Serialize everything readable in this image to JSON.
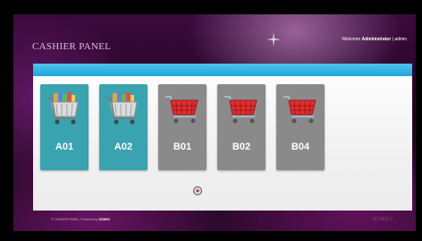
{
  "header": {
    "title": "CASHIER PANEL",
    "welcome_prefix": "Welcome",
    "user": "Administrator",
    "separator": "|",
    "logout_label": "admin"
  },
  "registers": [
    {
      "label": "A01",
      "status": "occupied",
      "icon": "full-cart-icon",
      "color": "#3aa3b0"
    },
    {
      "label": "A02",
      "status": "occupied",
      "icon": "full-cart-icon",
      "color": "#3aa3b0"
    },
    {
      "label": "B01",
      "status": "empty",
      "icon": "empty-cart-icon",
      "color": "#8a8a8a"
    },
    {
      "label": "B02",
      "status": "empty",
      "icon": "empty-cart-icon",
      "color": "#8a8a8a"
    },
    {
      "label": "B04",
      "status": "empty",
      "icon": "empty-cart-icon",
      "color": "#8a8a8a"
    }
  ],
  "footer": {
    "copyright": "© CASHIER PANEL | Powered by",
    "brand": "SCMSC",
    "right_text": "SCMSC"
  },
  "colors": {
    "accent_bar": "#1fa7dd",
    "occupied_tile": "#3aa3b0",
    "empty_tile": "#8a8a8a"
  }
}
